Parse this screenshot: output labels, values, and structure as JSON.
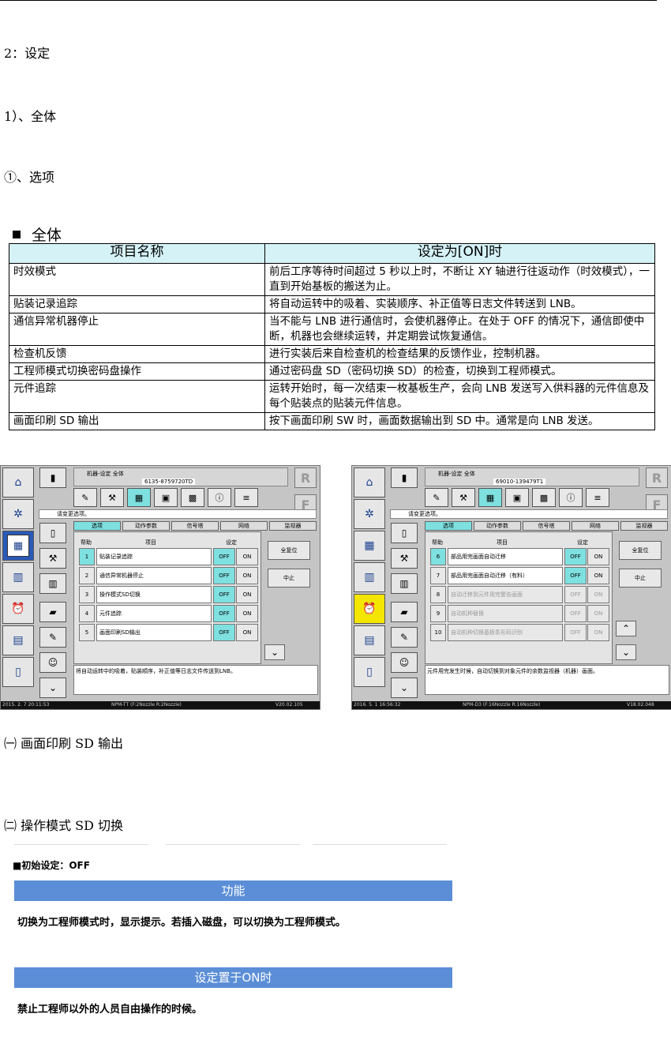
{
  "headings": {
    "h1": "2：设定",
    "h2": "1）、全体",
    "h3": "①、选项"
  },
  "section_title": "全体",
  "table": {
    "col1_header": "项目名称",
    "col2_header": "设定为[ON]时",
    "rows": [
      {
        "name": "时效模式",
        "desc": "前后工序等待时间超过 5 秒以上时，不断让 XY 轴进行往返动作（时效模式），一直到开始基板的搬送为止。"
      },
      {
        "name": "贴装记录追踪",
        "desc": "将自动运转中的吸着、实装顺序、补正值等日志文件转送到 LNB。"
      },
      {
        "name": "通信异常机器停止",
        "desc": "当不能与 LNB 进行通信时，会使机器停止。在处于 OFF 的情况下，通信即使中断，机器也会继续运转，并定期尝试恢复通信。"
      },
      {
        "name": "检查机反馈",
        "desc": "进行实装后来自检查机的检查结果的反馈作业，控制机器。"
      },
      {
        "name": "工程师模式切换密码盘操作",
        "desc": "通过密码盘 SD（密码切换 SD）的检查，切换到工程师模式。"
      },
      {
        "name": "元件追踪",
        "desc": "运转开始时，每一次结束一枚基板生产，会向 LNB 发送写入供料器的元件信息及每个贴装点的贴装元件信息。"
      },
      {
        "name": "画面印刷 SD 输出",
        "desc": "按下画面印刷 SW 时，画面数据输出到 SD 中。通常是向 LNB 发送。"
      }
    ]
  },
  "screens": [
    {
      "title": "机器-设定 全体",
      "machine_id": "6135-8759720TD",
      "hint": "请变更选项。",
      "tabs": [
        "选项",
        "动作参数",
        "信号塔",
        "网络",
        "监视器"
      ],
      "col_help": "帮助",
      "col_item": "项目",
      "col_set": "设定",
      "rows": [
        {
          "num": "1",
          "name": "贴装记录追踪",
          "off": "OFF",
          "on": "ON",
          "dim": false
        },
        {
          "num": "2",
          "name": "通信异常机器停止",
          "off": "OFF",
          "on": "ON",
          "dim": false
        },
        {
          "num": "3",
          "name": "操作模式SD切换",
          "off": "OFF",
          "on": "ON",
          "dim": false
        },
        {
          "num": "4",
          "name": "元件追踪",
          "off": "OFF",
          "on": "ON",
          "dim": false
        },
        {
          "num": "5",
          "name": "画面印刷SD输出",
          "off": "OFF",
          "on": "ON",
          "dim": false
        }
      ],
      "btn_reset": "全复位",
      "btn_stop": "中止",
      "desc": "将自动运转中的吸着，贴装顺序，补正值等日志文件传送到LNB。",
      "status_left": "2015. 2. 7 20:11:53",
      "status_mid": "NPM-TT (F:2Nozzle R:2Nozzle)",
      "status_right": "V20.02.105"
    },
    {
      "title": "机器-设定 全体",
      "machine_id": "69010-139479T1",
      "hint": "请变更选项。",
      "tabs": [
        "选项",
        "动作参数",
        "信号塔",
        "网络",
        "监视器"
      ],
      "col_help": "帮助",
      "col_item": "项目",
      "col_set": "设定",
      "rows": [
        {
          "num": "6",
          "name": "部品用完画面自动迁移",
          "off": "OFF",
          "on": "ON",
          "dim": false
        },
        {
          "num": "7",
          "name": "部品用完画面自动迁移（有料）",
          "off": "OFF",
          "on": "ON",
          "dim": false
        },
        {
          "num": "8",
          "name": "自动迁移到元件用完警告画面",
          "off": "OFF",
          "on": "ON",
          "dim": true
        },
        {
          "num": "9",
          "name": "自动机种替换",
          "off": "OFF",
          "on": "ON",
          "dim": true
        },
        {
          "num": "10",
          "name": "自动机种切换基板条形码识别",
          "off": "OFF",
          "on": "ON",
          "dim": true
        }
      ],
      "btn_reset": "全复位",
      "btn_stop": "中止",
      "desc": "元件用完发生时候，自动切换到对象元件的余数监视器（机器）画面。",
      "status_left": "2016. 5. 1 16:56:32",
      "status_mid": "NPM-D3 (F:16Nozzle R:16Nozzle)",
      "status_right": "V18.02.048"
    }
  ],
  "sub1": "㈠ 画面印刷 SD 输出",
  "sub2": "㈡ 操作模式 SD 切换",
  "initial": "■初始设定：OFF",
  "bar1": "功能",
  "text1": "切换为工程师模式时，显示提示。若插入磁盘，可以切换为工程师模式。",
  "bar2": "设定置于ON时",
  "text2": "禁止工程师以外的人员自由操作的时候。",
  "colors": {
    "header_bg": "#d5f2f7",
    "bar_bg": "#5b8ed6",
    "cyan_button": "#7fe0e0"
  }
}
